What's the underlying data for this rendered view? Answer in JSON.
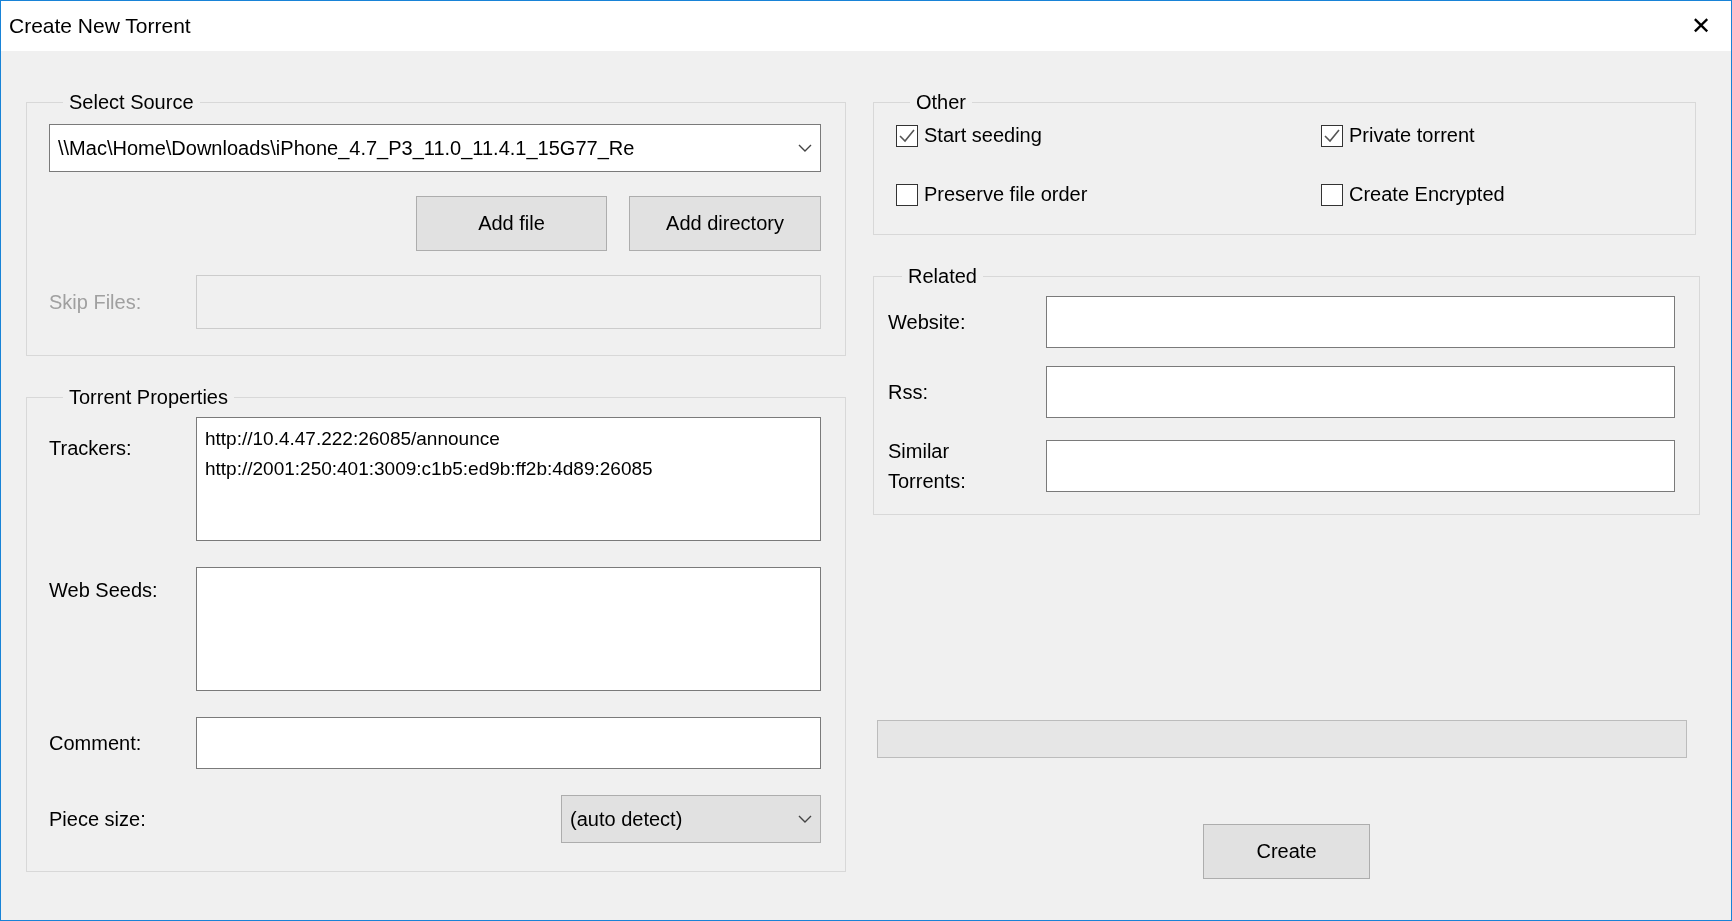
{
  "window": {
    "title": "Create New Torrent",
    "close": "✕"
  },
  "select_source": {
    "title": "Select Source",
    "source": {
      "value": "\\\\Mac\\Home\\Downloads\\iPhone_4.7_P3_11.0_11.4.1_15G77_Re"
    },
    "buttons": [
      "Add file",
      "Add directory"
    ],
    "skip_files": {
      "label": "Skip Files:",
      "disabled": true
    }
  },
  "torrent_properties": {
    "title": "Torrent Properties",
    "trackers": {
      "label": "Trackers:",
      "lines": [
        "http://10.4.47.222:26085/announce",
        "http://2001:250:401:3009:c1b5:ed9b:ff2b:4d89:26085"
      ]
    },
    "web_seeds": {
      "label": "Web Seeds:"
    },
    "comment": {
      "label": "Comment:"
    },
    "piece_size": {
      "label": "Piece size:",
      "value": "(auto detect)"
    }
  },
  "other": {
    "title": "Other",
    "options": [
      {
        "label": "Start seeding",
        "checked": true
      },
      {
        "label": "Private torrent",
        "checked": true
      },
      {
        "label": "Preserve file order",
        "checked": false
      },
      {
        "label": "Create Encrypted",
        "checked": false
      }
    ]
  },
  "related": {
    "title": "Related",
    "fields": [
      {
        "label": "Website:"
      },
      {
        "label": "Rss:"
      },
      {
        "label": "Similar Torrents:"
      }
    ]
  },
  "progress": {
    "level": 0
  },
  "create_button": "Create"
}
